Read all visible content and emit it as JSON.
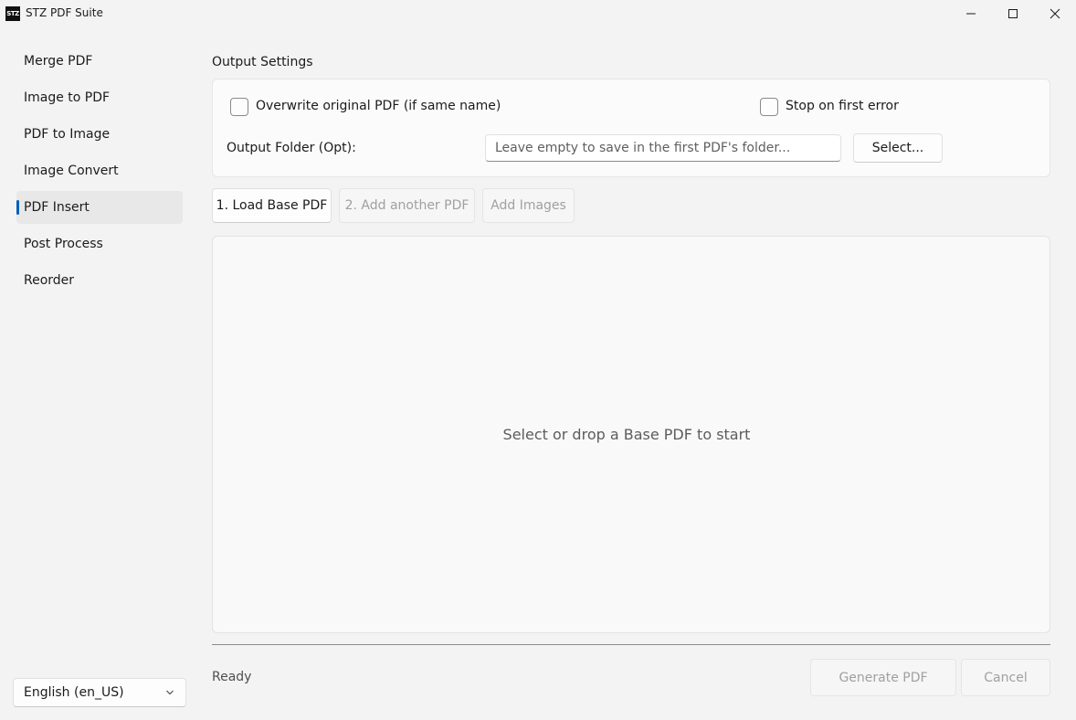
{
  "window": {
    "title": "STZ PDF Suite",
    "logo_text": "STZ",
    "controls": [
      "minimize",
      "maximize",
      "close"
    ]
  },
  "sidebar": {
    "items": [
      {
        "label": "Merge PDF",
        "active": false
      },
      {
        "label": "Image to PDF",
        "active": false
      },
      {
        "label": "PDF to Image",
        "active": false
      },
      {
        "label": "Image Convert",
        "active": false
      },
      {
        "label": "PDF Insert",
        "active": true
      },
      {
        "label": "Post Process",
        "active": false
      },
      {
        "label": "Reorder",
        "active": false
      }
    ],
    "language": {
      "selected": "English (en_US)"
    }
  },
  "output_settings": {
    "title": "Output Settings",
    "overwrite_label": "Overwrite original PDF (if same name)",
    "overwrite_checked": false,
    "stop_label": "Stop on first error",
    "stop_checked": false,
    "folder_label": "Output Folder (Opt):",
    "folder_value": "",
    "folder_placeholder": "Leave empty to save in the first PDF's folder...",
    "select_button": "Select..."
  },
  "actions": {
    "load_base": "1. Load Base PDF",
    "add_another": "2. Add another PDF",
    "add_images": "Add Images"
  },
  "drop_area": {
    "text": "Select or drop a Base PDF to start"
  },
  "footer": {
    "status": "Ready",
    "generate": "Generate PDF",
    "cancel": "Cancel"
  },
  "colors": {
    "accent": "#005fb8",
    "background": "#f3f3f3",
    "disabled_text": "#a0a0a0"
  }
}
